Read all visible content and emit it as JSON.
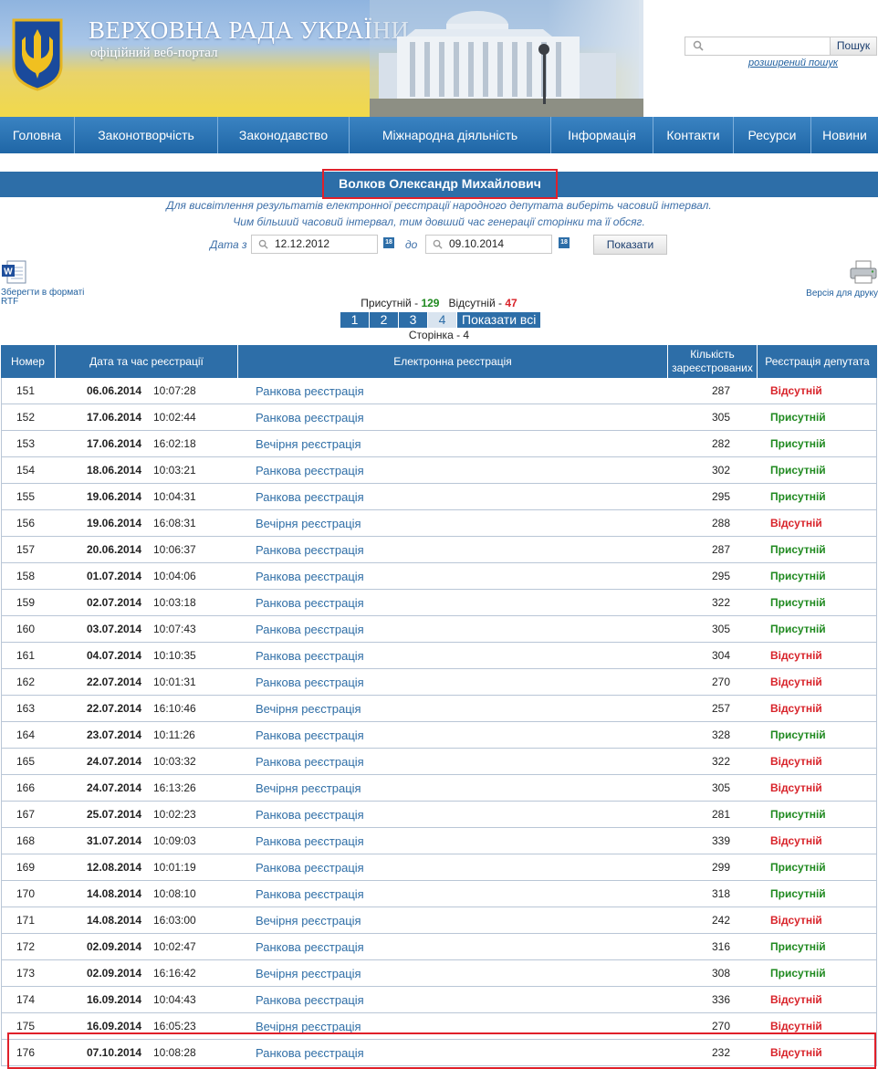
{
  "header": {
    "title": "ВЕРХОВНА РАДА УКРАЇНИ",
    "subtitle": "офіційний веб-портал",
    "search_button": "Пошук",
    "search_placeholder": "",
    "advanced_search": "розширений пошук"
  },
  "nav": [
    "Головна",
    "Законотворчість",
    "Законодавство",
    "Міжнародна діяльність",
    "Інформація",
    "Контакти",
    "Ресурси",
    "Новини"
  ],
  "deputy_name": "Волков Олександр Михайлович",
  "hints": [
    "Для висвітлення результатів електронної реєстрації народного депутата виберіть часовий інтервал.",
    "Чим більший часовий інтервал, тим довший час генерації сторінки та її обсяг."
  ],
  "filter": {
    "from_label": "Дата з",
    "from_value": "12.12.2012",
    "to_label": "до",
    "to_value": "09.10.2014",
    "show_button": "Показати",
    "calendar_icon_text": "18"
  },
  "rtf_label": "Зберегти в форматі RTF",
  "print_label": "Версія для друку",
  "stats": {
    "present_label": "Присутній",
    "present_count": "129",
    "absent_label": "Відсутній",
    "absent_count": "47",
    "sep": "-"
  },
  "pager": {
    "pages": [
      "1",
      "2",
      "3",
      "4"
    ],
    "current": "4",
    "show_all": "Показати всі"
  },
  "page_label": "Сторінка - 4",
  "colors": {
    "accent": "#2d6ea8",
    "present": "#208a20",
    "absent": "#d8232a",
    "highlight": "#e0202a"
  },
  "table": {
    "headers": [
      "Номер",
      "Дата та час реєстрації",
      "Електронна реєстрація",
      "Кількість зареєстрованих",
      "Реєстрація депутата"
    ],
    "rows": [
      {
        "num": "151",
        "date": "06.06.2014",
        "time": "10:07:28",
        "reg": "Ранкова реєстрація",
        "count": "287",
        "status": "Відсутній",
        "present": false
      },
      {
        "num": "152",
        "date": "17.06.2014",
        "time": "10:02:44",
        "reg": "Ранкова реєстрація",
        "count": "305",
        "status": "Присутній",
        "present": true
      },
      {
        "num": "153",
        "date": "17.06.2014",
        "time": "16:02:18",
        "reg": "Вечірня реєстрація",
        "count": "282",
        "status": "Присутній",
        "present": true
      },
      {
        "num": "154",
        "date": "18.06.2014",
        "time": "10:03:21",
        "reg": "Ранкова реєстрація",
        "count": "302",
        "status": "Присутній",
        "present": true
      },
      {
        "num": "155",
        "date": "19.06.2014",
        "time": "10:04:31",
        "reg": "Ранкова реєстрація",
        "count": "295",
        "status": "Присутній",
        "present": true
      },
      {
        "num": "156",
        "date": "19.06.2014",
        "time": "16:08:31",
        "reg": "Вечірня реєстрація",
        "count": "288",
        "status": "Відсутній",
        "present": false
      },
      {
        "num": "157",
        "date": "20.06.2014",
        "time": "10:06:37",
        "reg": "Ранкова реєстрація",
        "count": "287",
        "status": "Присутній",
        "present": true
      },
      {
        "num": "158",
        "date": "01.07.2014",
        "time": "10:04:06",
        "reg": "Ранкова реєстрація",
        "count": "295",
        "status": "Присутній",
        "present": true
      },
      {
        "num": "159",
        "date": "02.07.2014",
        "time": "10:03:18",
        "reg": "Ранкова реєстрація",
        "count": "322",
        "status": "Присутній",
        "present": true
      },
      {
        "num": "160",
        "date": "03.07.2014",
        "time": "10:07:43",
        "reg": "Ранкова реєстрація",
        "count": "305",
        "status": "Присутній",
        "present": true
      },
      {
        "num": "161",
        "date": "04.07.2014",
        "time": "10:10:35",
        "reg": "Ранкова реєстрація",
        "count": "304",
        "status": "Відсутній",
        "present": false
      },
      {
        "num": "162",
        "date": "22.07.2014",
        "time": "10:01:31",
        "reg": "Ранкова реєстрація",
        "count": "270",
        "status": "Відсутній",
        "present": false
      },
      {
        "num": "163",
        "date": "22.07.2014",
        "time": "16:10:46",
        "reg": "Вечірня реєстрація",
        "count": "257",
        "status": "Відсутній",
        "present": false
      },
      {
        "num": "164",
        "date": "23.07.2014",
        "time": "10:11:26",
        "reg": "Ранкова реєстрація",
        "count": "328",
        "status": "Присутній",
        "present": true
      },
      {
        "num": "165",
        "date": "24.07.2014",
        "time": "10:03:32",
        "reg": "Ранкова реєстрація",
        "count": "322",
        "status": "Відсутній",
        "present": false
      },
      {
        "num": "166",
        "date": "24.07.2014",
        "time": "16:13:26",
        "reg": "Вечірня реєстрація",
        "count": "305",
        "status": "Відсутній",
        "present": false
      },
      {
        "num": "167",
        "date": "25.07.2014",
        "time": "10:02:23",
        "reg": "Ранкова реєстрація",
        "count": "281",
        "status": "Присутній",
        "present": true
      },
      {
        "num": "168",
        "date": "31.07.2014",
        "time": "10:09:03",
        "reg": "Ранкова реєстрація",
        "count": "339",
        "status": "Відсутній",
        "present": false
      },
      {
        "num": "169",
        "date": "12.08.2014",
        "time": "10:01:19",
        "reg": "Ранкова реєстрація",
        "count": "299",
        "status": "Присутній",
        "present": true
      },
      {
        "num": "170",
        "date": "14.08.2014",
        "time": "10:08:10",
        "reg": "Ранкова реєстрація",
        "count": "318",
        "status": "Присутній",
        "present": true
      },
      {
        "num": "171",
        "date": "14.08.2014",
        "time": "16:03:00",
        "reg": "Вечірня реєстрація",
        "count": "242",
        "status": "Відсутній",
        "present": false
      },
      {
        "num": "172",
        "date": "02.09.2014",
        "time": "10:02:47",
        "reg": "Ранкова реєстрація",
        "count": "316",
        "status": "Присутній",
        "present": true
      },
      {
        "num": "173",
        "date": "02.09.2014",
        "time": "16:16:42",
        "reg": "Вечірня реєстрація",
        "count": "308",
        "status": "Присутній",
        "present": true
      },
      {
        "num": "174",
        "date": "16.09.2014",
        "time": "10:04:43",
        "reg": "Ранкова реєстрація",
        "count": "336",
        "status": "Відсутній",
        "present": false
      },
      {
        "num": "175",
        "date": "16.09.2014",
        "time": "16:05:23",
        "reg": "Вечірня реєстрація",
        "count": "270",
        "status": "Відсутній",
        "present": false
      },
      {
        "num": "176",
        "date": "07.10.2014",
        "time": "10:08:28",
        "reg": "Ранкова реєстрація",
        "count": "232",
        "status": "Відсутній",
        "present": false,
        "highlighted": true
      }
    ]
  }
}
